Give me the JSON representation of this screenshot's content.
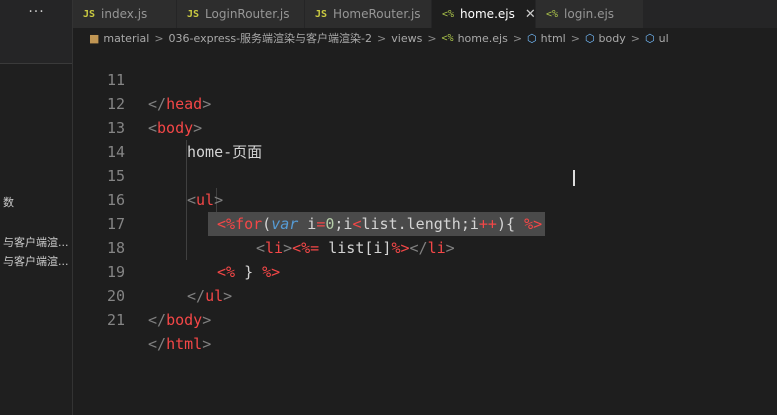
{
  "sidebar": {
    "more_label": "···",
    "items": [
      "数",
      "与客户端渲...",
      "与客户端渲..."
    ]
  },
  "tabs": [
    {
      "icon": "JS",
      "label": "index.js",
      "active": false
    },
    {
      "icon": "JS",
      "label": "LoginRouter.js",
      "active": false
    },
    {
      "icon": "JS",
      "label": "HomeRouter.js",
      "active": false
    },
    {
      "icon": "<%",
      "label": "home.ejs",
      "active": true,
      "close": "✕"
    },
    {
      "icon": "<%",
      "label": "login.ejs",
      "active": false
    }
  ],
  "breadcrumb": {
    "parts": [
      "material",
      "036-express-服务端渲染与客户端渲染-2",
      "views",
      "home.ejs",
      "html",
      "body",
      "ul"
    ],
    "separator": ">"
  },
  "editor": {
    "line_numbers": [
      "11",
      "12",
      "13",
      "14",
      "15",
      "16",
      "17",
      "18",
      "19",
      "20",
      "21"
    ],
    "code": {
      "l11": {
        "open": "</",
        "name": "head",
        "close": ">"
      },
      "l12": {
        "open": "<",
        "name": "body",
        "close": ">"
      },
      "l13": {
        "text": "home-页面"
      },
      "l15": {
        "open": "<",
        "name": "ul",
        "close": ">"
      },
      "l16": {
        "d1": "<%",
        "kw": "for",
        "p1": "(",
        "var": "var",
        "t1": " i",
        "eq": "=",
        "num": "0",
        "t2": ";i",
        "lt": "<",
        "t3": "list.length;i",
        "inc": "++",
        "t4": "){ ",
        "d2": "%>"
      },
      "l17": {
        "lo": "<",
        "li1": "li",
        "lc": ">",
        "ejso": "<%=",
        "expr": " list[i]",
        "ejsc": "%>",
        "lo2": "</",
        "li2": "li",
        "lc2": ">"
      },
      "l18": {
        "d1": "<%",
        "t": " } ",
        "d2": "%>"
      },
      "l19": {
        "open": "</",
        "name": "ul",
        "close": ">"
      },
      "l20": {
        "open": "</",
        "name": "body",
        "close": ">"
      },
      "l21": {
        "open": "</",
        "name": "html",
        "close": ">"
      }
    }
  },
  "colors": {
    "background": "#1e1e1e",
    "tag": "#f44747",
    "keyword": "#569cd6",
    "number": "#b5cea8",
    "line_number": "#858585"
  }
}
